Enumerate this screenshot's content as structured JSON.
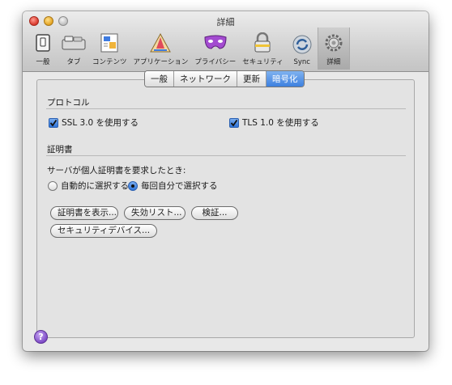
{
  "window": {
    "title": "詳細"
  },
  "toolbar": {
    "items": [
      {
        "label": "一般",
        "icon": "switch-icon"
      },
      {
        "label": "タブ",
        "icon": "tabs-icon"
      },
      {
        "label": "コンテンツ",
        "icon": "content-icon"
      },
      {
        "label": "アプリケーション",
        "icon": "applications-icon"
      },
      {
        "label": "プライバシー",
        "icon": "mask-icon"
      },
      {
        "label": "セキュリティ",
        "icon": "lock-icon"
      },
      {
        "label": "Sync",
        "icon": "sync-icon"
      },
      {
        "label": "詳細",
        "icon": "gear-icon"
      }
    ]
  },
  "tabs": [
    "一般",
    "ネットワーク",
    "更新",
    "暗号化"
  ],
  "active_tab": "暗号化",
  "protocol": {
    "heading": "プロトコル",
    "ssl_label": "SSL 3.0 を使用する",
    "tls_label": "TLS 1.0 を使用する"
  },
  "certificates": {
    "heading": "証明書",
    "prompt": "サーバが個人証明書を要求したとき:",
    "radio_auto": "自動的に選択する",
    "radio_ask": "毎回自分で選択する",
    "btn_view": "証明書を表示...",
    "btn_revocation": "失効リスト...",
    "btn_validation": "検証...",
    "btn_devices": "セキュリティデバイス..."
  },
  "help": "?",
  "colors": {
    "accent": "#3d80df",
    "help": "#7a46c4"
  }
}
